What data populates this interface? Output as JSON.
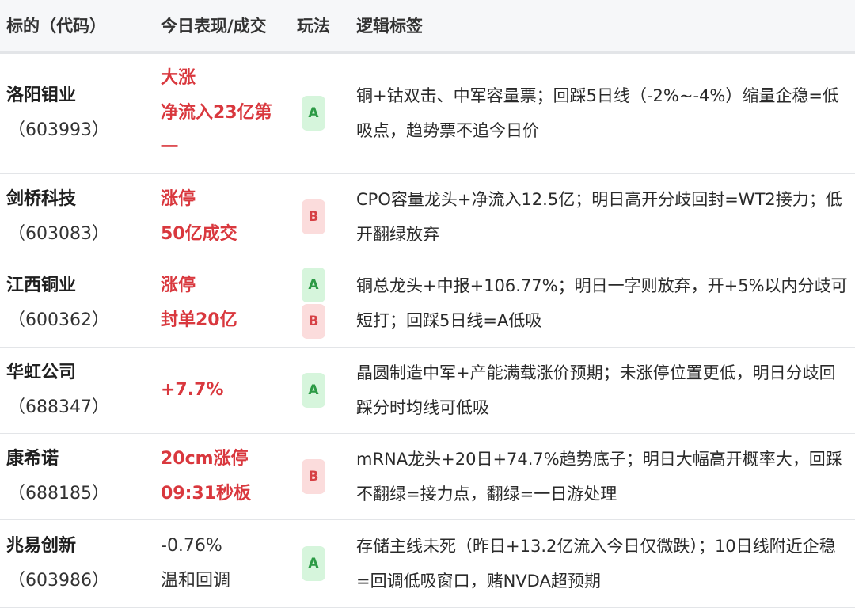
{
  "header": {
    "col_stock": "标的（代码）",
    "col_perf": "今日表现/成交",
    "col_play": "玩法",
    "col_logic": "逻辑标签"
  },
  "rows": [
    {
      "name": "洛阳钼业",
      "code": "（603993）",
      "perf": [
        "大涨",
        "净流入23亿第",
        "一"
      ],
      "perf_red": true,
      "badges": [
        "A"
      ],
      "logic": "铜+钴双击、中军容量票；回踩5日线（-2%~-4%）缩量企稳=低吸点，趋势票不追今日价"
    },
    {
      "name": "剑桥科技",
      "code": "（603083）",
      "perf": [
        "涨停",
        "50亿成交"
      ],
      "perf_red": true,
      "badges": [
        "B"
      ],
      "logic": "CPO容量龙头+净流入12.5亿；明日高开分歧回封=WT2接力；低开翻绿放弃"
    },
    {
      "name": "江西铜业",
      "code": "（600362）",
      "perf": [
        "涨停",
        "封单20亿"
      ],
      "perf_red": true,
      "badges": [
        "A",
        "B"
      ],
      "logic": "铜总龙头+中报+106.77%；明日一字则放弃，开+5%以内分歧可短打；回踩5日线=A低吸"
    },
    {
      "name": "华虹公司",
      "code": "（688347）",
      "perf": [
        "+7.7%"
      ],
      "perf_red": true,
      "badges": [
        "A"
      ],
      "logic": "晶圆制造中军+产能满载涨价预期；未涨停位置更低，明日分歧回踩分时均线可低吸"
    },
    {
      "name": "康希诺",
      "code": "（688185）",
      "perf": [
        "20cm涨停",
        "09:31秒板"
      ],
      "perf_red": true,
      "badges": [
        "B"
      ],
      "logic": "mRNA龙头+20日+74.7%趋势底子；明日大幅高开概率大，回踩不翻绿=接力点，翻绿=一日游处理"
    },
    {
      "name": "兆易创新",
      "code": "（603986）",
      "perf": [
        "-0.76%",
        "温和回调"
      ],
      "perf_red": false,
      "badges": [
        "A"
      ],
      "logic": "存储主线未死（昨日+13.2亿流入今日仅微跌）；10日线附近企稳=回调低吸窗口，赌NVDA超预期"
    }
  ]
}
